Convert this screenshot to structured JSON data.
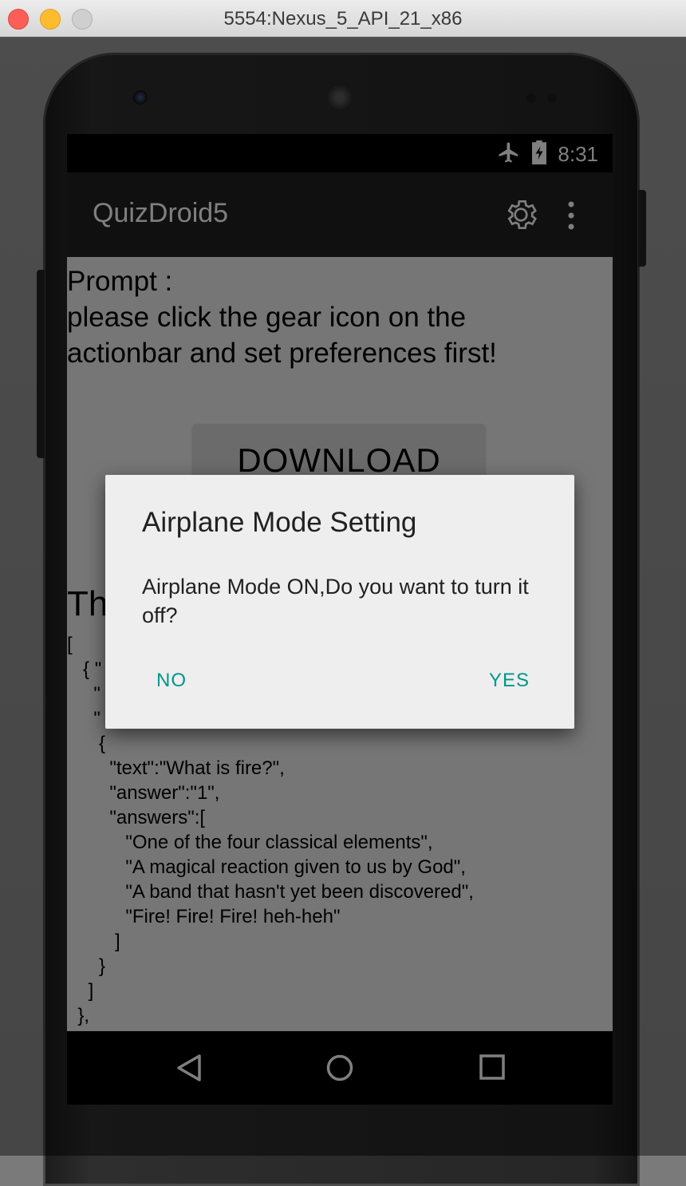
{
  "window": {
    "title": "5554:Nexus_5_API_21_x86"
  },
  "statusbar": {
    "time": "8:31",
    "airplane_icon": "airplane-icon",
    "battery_icon": "battery-charging-icon"
  },
  "actionbar": {
    "title": "QuizDroid5",
    "settings_icon": "gear-icon",
    "menu_icon": "overflow-menu-icon"
  },
  "main": {
    "prompt_line1": "Prompt :",
    "prompt_line2": "please click the gear icon on the",
    "prompt_line3": "actionbar and set preferences first!",
    "download_label": "DOWNLOAD",
    "section_heading_partial": "Th",
    "json_text": "[\n   { \"\n     \"\n     \"\n      {\n        \"text\":\"What is fire?\",\n        \"answer\":\"1\",\n        \"answers\":[\n           \"One of the four classical elements\",\n           \"A magical reaction given to us by God\",\n           \"A band that hasn't yet been discovered\",\n           \"Fire! Fire! Fire! heh-heh\"\n         ]\n      }\n    ]\n  },"
  },
  "navbar": {
    "back_icon": "back-icon",
    "home_icon": "home-icon",
    "recents_icon": "recents-icon"
  },
  "dialog": {
    "title": "Airplane Mode Setting",
    "message": "Airplane Mode ON,Do you want to turn it off?",
    "negative_label": "NO",
    "positive_label": "YES",
    "accent_color": "#009688"
  }
}
